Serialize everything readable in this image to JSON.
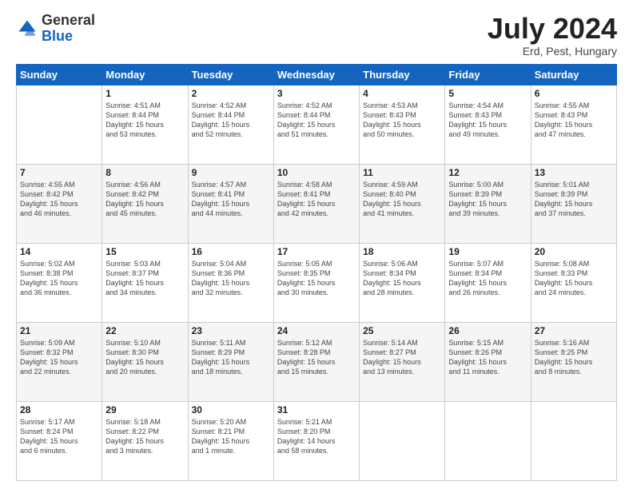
{
  "logo": {
    "general": "General",
    "blue": "Blue"
  },
  "title": "July 2024",
  "subtitle": "Erd, Pest, Hungary",
  "days_of_week": [
    "Sunday",
    "Monday",
    "Tuesday",
    "Wednesday",
    "Thursday",
    "Friday",
    "Saturday"
  ],
  "weeks": [
    [
      {
        "day": "",
        "info": ""
      },
      {
        "day": "1",
        "info": "Sunrise: 4:51 AM\nSunset: 8:44 PM\nDaylight: 15 hours\nand 53 minutes."
      },
      {
        "day": "2",
        "info": "Sunrise: 4:52 AM\nSunset: 8:44 PM\nDaylight: 15 hours\nand 52 minutes."
      },
      {
        "day": "3",
        "info": "Sunrise: 4:52 AM\nSunset: 8:44 PM\nDaylight: 15 hours\nand 51 minutes."
      },
      {
        "day": "4",
        "info": "Sunrise: 4:53 AM\nSunset: 8:43 PM\nDaylight: 15 hours\nand 50 minutes."
      },
      {
        "day": "5",
        "info": "Sunrise: 4:54 AM\nSunset: 8:43 PM\nDaylight: 15 hours\nand 49 minutes."
      },
      {
        "day": "6",
        "info": "Sunrise: 4:55 AM\nSunset: 8:43 PM\nDaylight: 15 hours\nand 47 minutes."
      }
    ],
    [
      {
        "day": "7",
        "info": "Sunrise: 4:55 AM\nSunset: 8:42 PM\nDaylight: 15 hours\nand 46 minutes."
      },
      {
        "day": "8",
        "info": "Sunrise: 4:56 AM\nSunset: 8:42 PM\nDaylight: 15 hours\nand 45 minutes."
      },
      {
        "day": "9",
        "info": "Sunrise: 4:57 AM\nSunset: 8:41 PM\nDaylight: 15 hours\nand 44 minutes."
      },
      {
        "day": "10",
        "info": "Sunrise: 4:58 AM\nSunset: 8:41 PM\nDaylight: 15 hours\nand 42 minutes."
      },
      {
        "day": "11",
        "info": "Sunrise: 4:59 AM\nSunset: 8:40 PM\nDaylight: 15 hours\nand 41 minutes."
      },
      {
        "day": "12",
        "info": "Sunrise: 5:00 AM\nSunset: 8:39 PM\nDaylight: 15 hours\nand 39 minutes."
      },
      {
        "day": "13",
        "info": "Sunrise: 5:01 AM\nSunset: 8:39 PM\nDaylight: 15 hours\nand 37 minutes."
      }
    ],
    [
      {
        "day": "14",
        "info": "Sunrise: 5:02 AM\nSunset: 8:38 PM\nDaylight: 15 hours\nand 36 minutes."
      },
      {
        "day": "15",
        "info": "Sunrise: 5:03 AM\nSunset: 8:37 PM\nDaylight: 15 hours\nand 34 minutes."
      },
      {
        "day": "16",
        "info": "Sunrise: 5:04 AM\nSunset: 8:36 PM\nDaylight: 15 hours\nand 32 minutes."
      },
      {
        "day": "17",
        "info": "Sunrise: 5:05 AM\nSunset: 8:35 PM\nDaylight: 15 hours\nand 30 minutes."
      },
      {
        "day": "18",
        "info": "Sunrise: 5:06 AM\nSunset: 8:34 PM\nDaylight: 15 hours\nand 28 minutes."
      },
      {
        "day": "19",
        "info": "Sunrise: 5:07 AM\nSunset: 8:34 PM\nDaylight: 15 hours\nand 26 minutes."
      },
      {
        "day": "20",
        "info": "Sunrise: 5:08 AM\nSunset: 8:33 PM\nDaylight: 15 hours\nand 24 minutes."
      }
    ],
    [
      {
        "day": "21",
        "info": "Sunrise: 5:09 AM\nSunset: 8:32 PM\nDaylight: 15 hours\nand 22 minutes."
      },
      {
        "day": "22",
        "info": "Sunrise: 5:10 AM\nSunset: 8:30 PM\nDaylight: 15 hours\nand 20 minutes."
      },
      {
        "day": "23",
        "info": "Sunrise: 5:11 AM\nSunset: 8:29 PM\nDaylight: 15 hours\nand 18 minutes."
      },
      {
        "day": "24",
        "info": "Sunrise: 5:12 AM\nSunset: 8:28 PM\nDaylight: 15 hours\nand 15 minutes."
      },
      {
        "day": "25",
        "info": "Sunrise: 5:14 AM\nSunset: 8:27 PM\nDaylight: 15 hours\nand 13 minutes."
      },
      {
        "day": "26",
        "info": "Sunrise: 5:15 AM\nSunset: 8:26 PM\nDaylight: 15 hours\nand 11 minutes."
      },
      {
        "day": "27",
        "info": "Sunrise: 5:16 AM\nSunset: 8:25 PM\nDaylight: 15 hours\nand 8 minutes."
      }
    ],
    [
      {
        "day": "28",
        "info": "Sunrise: 5:17 AM\nSunset: 8:24 PM\nDaylight: 15 hours\nand 6 minutes."
      },
      {
        "day": "29",
        "info": "Sunrise: 5:18 AM\nSunset: 8:22 PM\nDaylight: 15 hours\nand 3 minutes."
      },
      {
        "day": "30",
        "info": "Sunrise: 5:20 AM\nSunset: 8:21 PM\nDaylight: 15 hours\nand 1 minute."
      },
      {
        "day": "31",
        "info": "Sunrise: 5:21 AM\nSunset: 8:20 PM\nDaylight: 14 hours\nand 58 minutes."
      },
      {
        "day": "",
        "info": ""
      },
      {
        "day": "",
        "info": ""
      },
      {
        "day": "",
        "info": ""
      }
    ]
  ]
}
